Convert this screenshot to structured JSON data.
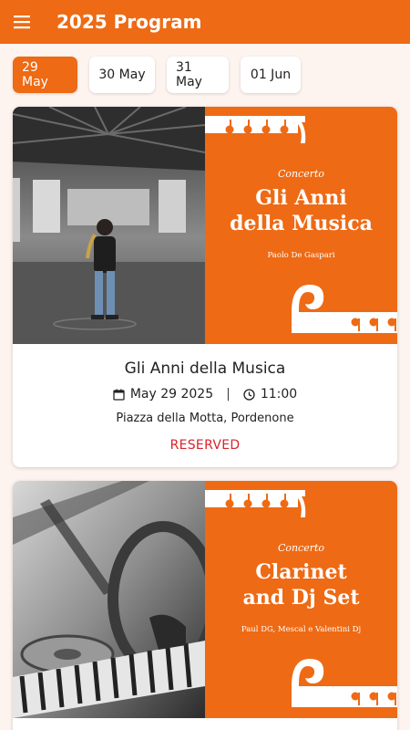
{
  "appbar": {
    "title": "2025 Program",
    "menu_icon": "menu-icon"
  },
  "date_tabs": [
    {
      "label": "29 May",
      "selected": true
    },
    {
      "label": "30 May",
      "selected": false
    },
    {
      "label": "31 May",
      "selected": false
    },
    {
      "label": "01 Jun",
      "selected": false
    }
  ],
  "events": [
    {
      "poster": {
        "kicker": "Concerto",
        "title_line1": "Gli Anni",
        "title_line2": "della Musica",
        "artists": "Paolo De Gaspari"
      },
      "title": "Gli Anni della Musica",
      "date": "May 29 2025",
      "time": "11:00",
      "venue": "Piazza della Motta, Pordenone",
      "status": "RESERVED"
    },
    {
      "poster": {
        "kicker": "Concerto",
        "title_line1": "Clarinet",
        "title_line2": "and Dj Set",
        "artists": "Paul DG, Mescal e Valentini Dj"
      }
    }
  ],
  "colors": {
    "accent": "#ee6a14",
    "reserved": "#d8232a",
    "background": "#fdf4f0"
  }
}
